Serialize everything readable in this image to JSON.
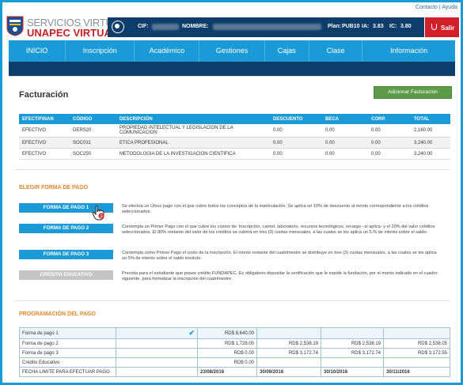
{
  "top_links": {
    "contacto": "Contacto",
    "separator": "|",
    "ayuda": "Ayuda"
  },
  "brand": {
    "line1": "SERVICIOS VIRTUALES",
    "line2": "UNAPEC VIRTUAL"
  },
  "info_bar": {
    "cif_label": "CIF:",
    "nombre_label": "NOMBRE:",
    "plan_label": "Plan:",
    "plan_value": "PUB10",
    "ia_label": "IA:",
    "ia_value": "3.83",
    "ic_label": "IC:",
    "ic_value": "3.80"
  },
  "salir_label": "Salir",
  "nav": [
    "INICIO",
    "Inscripción",
    "Académico",
    "Gestiones",
    "Cajas",
    "Clase",
    "Información"
  ],
  "facturacion": {
    "title": "Facturación",
    "add_button": "Adicionar Facturación",
    "headers": [
      "EFECT/FINAN",
      "CÓDIGO",
      "DESCRIPCIÓN",
      "DESCUENTO",
      "BECA",
      "CORP.",
      "TOTAL"
    ],
    "rows": [
      [
        "EFECTIVO",
        "DERS20",
        "PROPIEDAD INTELECTUAL Y LEGISLACION DE LA COMUNICACION",
        "0.00",
        "0.00",
        "0.00",
        "2,160.00"
      ],
      [
        "EFECTIVO",
        "SOC031",
        "ETICA PROFESIONAL",
        "0.00",
        "0.00",
        "0.00",
        "3,240.00"
      ],
      [
        "EFECTIVO",
        "SOC250",
        "METODOLOGIA DE LA INVESTIGACION CIENTIFICA",
        "0.00",
        "0.00",
        "0.00",
        "3,240.00"
      ]
    ]
  },
  "elegir": {
    "title": "ELEGIR FORMA DE PAGO",
    "options": [
      {
        "label": "FORMA DE PAGO 1",
        "desc": "Se efectúa un Único pago con el que cubre todos los conceptos de la matriculación. Se aplica un 10% de descuento al monto correspondiente a los créditos seleccionados."
      },
      {
        "label": "FORMA DE PAGO 2",
        "desc": "Contempla un Primer Pago con el que cubre los costos de: Inscripción, carnet, laboratorio, recursos tecnológicos, recargo –si aplica- y el 20% del valor créditos seleccionados. El 80% restante del valor de los créditos se cubrirá en tres (3) cuotas mensuales, a las cuales se les aplica un 5.% de interés sobre el saldo."
      },
      {
        "label": "FORMA DE PAGO 3",
        "desc": "Contempla como Primer Pago el costo de la Inscripción. El monto restante del cuatrimestre se distribuye en tres (3) cuotas mensuales, a las cuales se les aplica un 5% de interés sobre el saldo insoluto."
      },
      {
        "label": "CRÉDITO EDUCATIVO",
        "desc": "Prevista para el estudiante que posee crédito FUNDAPEC. Es obligatorio depositar la certificación que le expide la fundación, por el monto indicado en el cuadro siguiente, para formalizar la inscripción del cuatrimestre."
      }
    ],
    "cursor_badge": "1"
  },
  "programacion": {
    "title": "PROGRAMACIÓN DEL PAGO",
    "rows": [
      [
        "Forma de pago 1",
        "✔",
        "RD$ 8,640.00",
        "",
        "",
        ""
      ],
      [
        "Forma de pago 2",
        "",
        "RD$ 1,728.00",
        "RD$ 2,538.19",
        "RD$ 2,538.19",
        "RD$ 2,538.05"
      ],
      [
        "Forma de pago 3",
        "",
        "RD$ 0.00",
        "RD$ 3,172.74",
        "RD$ 3,172.74",
        "RD$ 3,172.55"
      ],
      [
        "Crédito Educativo",
        "",
        "RD$ 0.00",
        "",
        "",
        ""
      ],
      [
        "FECHA LIMITE PARA EFECTUAR PAGO",
        "",
        "23/08/2016",
        "30/09/2016",
        "30/10/2016",
        "30/11/2016"
      ]
    ]
  }
}
